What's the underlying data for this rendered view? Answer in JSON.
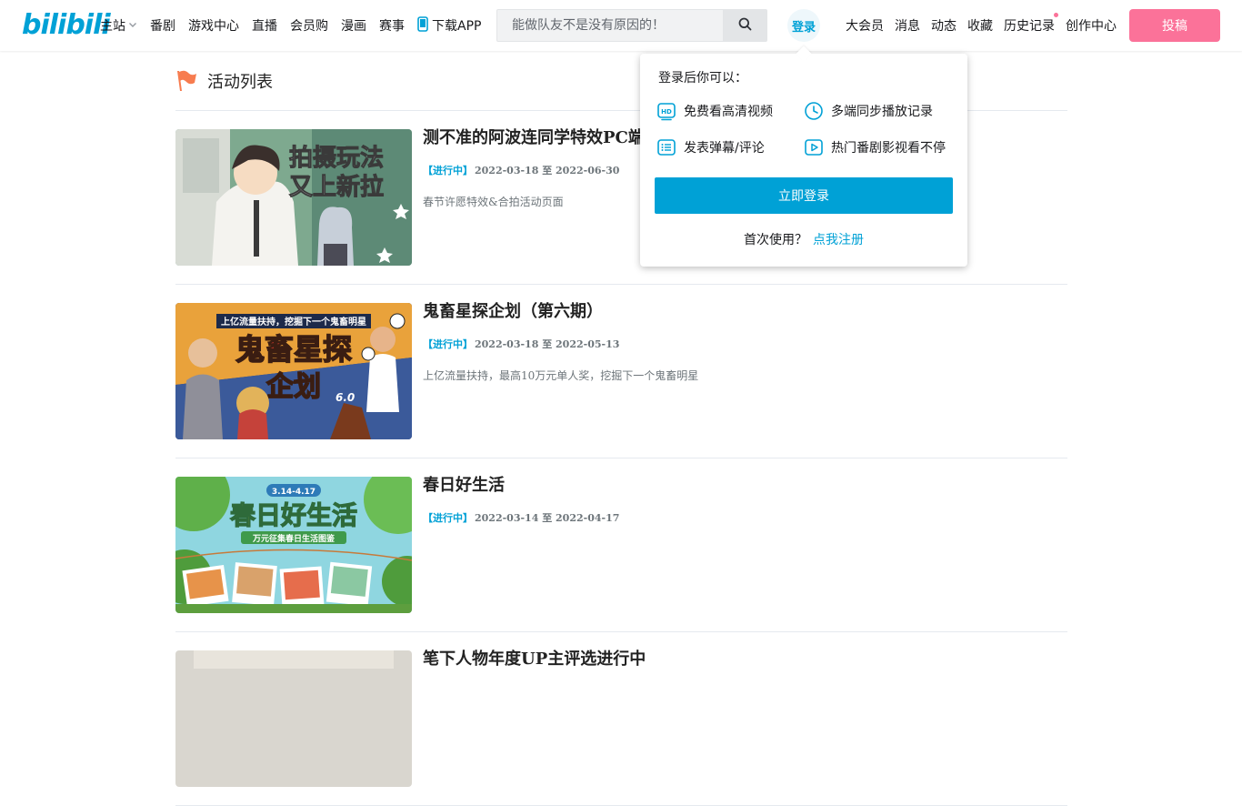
{
  "header": {
    "logo_text": "bilibili",
    "nav_left": [
      {
        "label": "主站",
        "has_chevron": true
      },
      {
        "label": "番剧"
      },
      {
        "label": "游戏中心"
      },
      {
        "label": "直播"
      },
      {
        "label": "会员购"
      },
      {
        "label": "漫画"
      },
      {
        "label": "赛事"
      },
      {
        "label": "下载APP",
        "icon": "phone-icon"
      }
    ],
    "search": {
      "placeholder": "能做队友不是没有原因的！",
      "value": ""
    },
    "login_avatar_label": "登录",
    "nav_right": [
      {
        "label": "大会员"
      },
      {
        "label": "消息"
      },
      {
        "label": "动态"
      },
      {
        "label": "收藏"
      },
      {
        "label": "历史记录",
        "has_dot": true
      },
      {
        "label": "创作中心"
      }
    ],
    "upload_label": "投稿"
  },
  "section": {
    "title": "活动列表"
  },
  "activities": [
    {
      "title": "测不准的阿波连同学特效PC端",
      "status": "【进行中】",
      "date_range": "2022-03-18 至 2022-06-30",
      "description": "春节许愿特效&合拍活动页面",
      "thumb_text": [
        "拍摄玩法",
        "又上新拉"
      ]
    },
    {
      "title": "鬼畜星探企划（第六期）",
      "status": "【进行中】",
      "date_range": "2022-03-18 至 2022-05-13",
      "description": "上亿流量扶持，最高10万元单人奖，挖掘下一个鬼畜明星",
      "thumb_text": [
        "上亿流量扶持，挖掘下一个鬼畜明星",
        "鬼畜星探",
        "企划",
        "6.0"
      ]
    },
    {
      "title": "春日好生活",
      "status": "【进行中】",
      "date_range": "2022-03-14 至 2022-04-17",
      "description": "",
      "thumb_text": [
        "3.14-4.17",
        "春日好生活",
        "万元征集春日生活图鉴"
      ]
    },
    {
      "title": "笔下人物年度UP主评选进行中",
      "status": "",
      "date_range": "",
      "description": ""
    }
  ],
  "login_popover": {
    "title": "登录后你可以：",
    "benefits": [
      {
        "label": "免费看高清视频",
        "icon": "hd-icon"
      },
      {
        "label": "多端同步播放记录",
        "icon": "clock-icon"
      },
      {
        "label": "发表弹幕/评论",
        "icon": "list-icon"
      },
      {
        "label": "热门番剧影视看不停",
        "icon": "play-icon"
      }
    ],
    "login_button": "立即登录",
    "register_prompt": "首次使用？",
    "register_link": "点我注册"
  },
  "colors": {
    "brand_blue": "#00a1d6",
    "brand_pink": "#fb7299",
    "flag_orange": "#f77c4f"
  }
}
